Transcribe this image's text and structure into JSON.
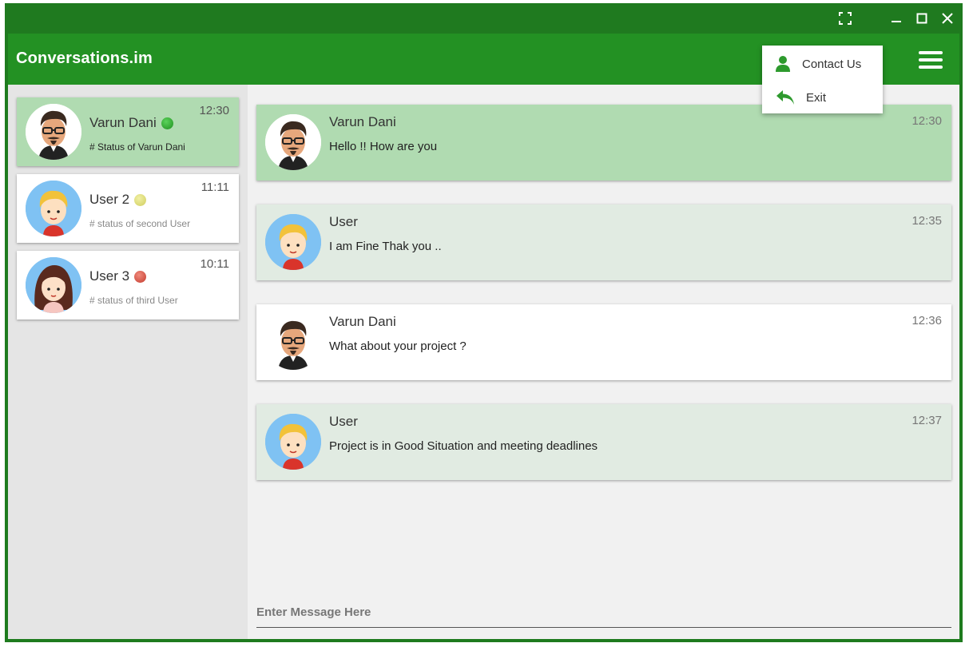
{
  "app": {
    "title": "Conversations.im",
    "accent": "#239123"
  },
  "window_controls": [
    "fullscreen-icon",
    "minimize-icon",
    "maximize-icon",
    "close-icon"
  ],
  "menu": {
    "items": [
      {
        "label": "Contact Us",
        "icon": "person-icon"
      },
      {
        "label": "Exit",
        "icon": "reply-icon"
      }
    ]
  },
  "contacts": [
    {
      "name": "Varun Dani",
      "status": "# Status of Varun Dani",
      "time": "12:30",
      "presence_color": "#2ea82e",
      "avatar": "man-glasses-avatar",
      "active": true
    },
    {
      "name": "User 2",
      "status": "# status of second User",
      "time": "11:11",
      "presence_color": "#e0df7a",
      "avatar": "blond-boy-avatar",
      "active": false
    },
    {
      "name": "User 3",
      "status": "# status of third User",
      "time": "10:11",
      "presence_color": "#d24a3c",
      "avatar": "girl-avatar",
      "active": false
    }
  ],
  "messages": [
    {
      "sender": "Varun Dani",
      "text": "Hello !! How are you",
      "time": "12:30",
      "bg": "#b0dbb1",
      "avatar": "man-glasses-avatar"
    },
    {
      "sender": "User",
      "text": "I am Fine Thak you ..",
      "time": "12:35",
      "bg": "#e1ebe2",
      "avatar": "blond-boy-avatar"
    },
    {
      "sender": "Varun Dani",
      "text": "What about your project ?",
      "time": "12:36",
      "bg": "#ffffff",
      "avatar": "man-glasses-avatar"
    },
    {
      "sender": "User",
      "text": "Project is in Good Situation and meeting deadlines",
      "time": "12:37",
      "bg": "#e1ebe2",
      "avatar": "blond-boy-avatar"
    }
  ],
  "composer": {
    "placeholder": "Enter Message Here",
    "value": ""
  }
}
